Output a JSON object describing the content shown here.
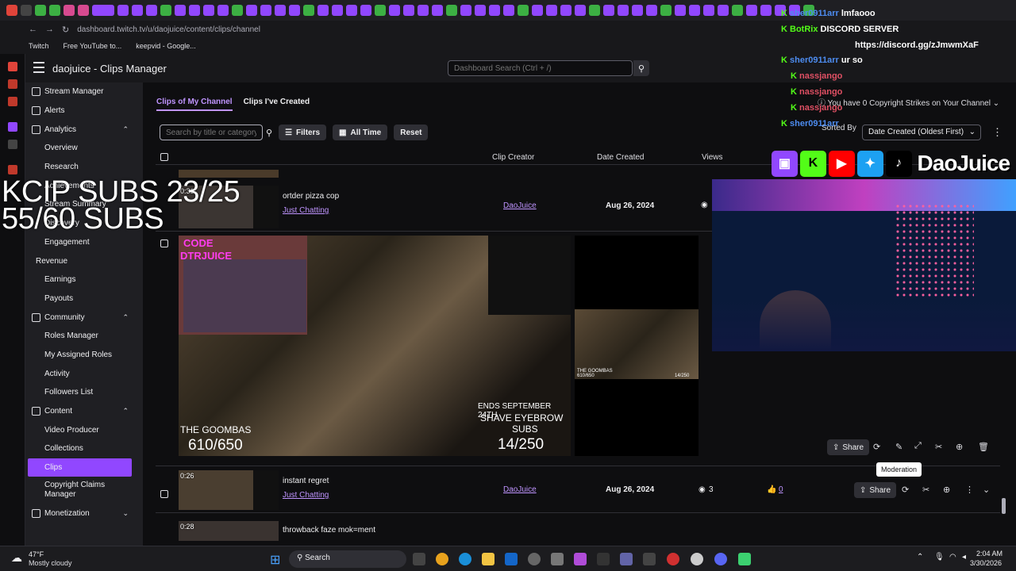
{
  "browser": {
    "url": "dashboard.twitch.tv/u/daojuice/content/clips/channel",
    "bookmarks": [
      "Twitch",
      "Free YouTube to...",
      "keepvid - Google..."
    ],
    "active_tab_label": "da"
  },
  "app": {
    "title": "daojuice - Clips Manager",
    "search_placeholder": "Dashboard Search (Ctrl + /)"
  },
  "nav": {
    "items": [
      {
        "label": "Stream Manager",
        "type": "top"
      },
      {
        "label": "Alerts",
        "type": "top"
      },
      {
        "label": "Analytics",
        "type": "top",
        "expanded": true
      },
      {
        "label": "Overview",
        "type": "sub"
      },
      {
        "label": "Research",
        "type": "sub"
      },
      {
        "label": "Achievements",
        "type": "sub"
      },
      {
        "label": "Stream Summary",
        "type": "sub"
      },
      {
        "label": "Discovery",
        "type": "sub"
      },
      {
        "label": "Engagement",
        "type": "sub"
      },
      {
        "label": "Revenue",
        "type": "sub-head"
      },
      {
        "label": "Earnings",
        "type": "sub"
      },
      {
        "label": "Payouts",
        "type": "sub"
      },
      {
        "label": "Community",
        "type": "top",
        "expanded": true
      },
      {
        "label": "Roles Manager",
        "type": "sub"
      },
      {
        "label": "My Assigned Roles",
        "type": "sub"
      },
      {
        "label": "Activity",
        "type": "sub"
      },
      {
        "label": "Followers List",
        "type": "sub"
      },
      {
        "label": "Content",
        "type": "top",
        "expanded": true
      },
      {
        "label": "Video Producer",
        "type": "sub"
      },
      {
        "label": "Collections",
        "type": "sub"
      },
      {
        "label": "Clips",
        "type": "sub",
        "active": true
      },
      {
        "label": "Copyright Claims Manager",
        "type": "sub"
      },
      {
        "label": "Monetization",
        "type": "top",
        "expanded": false
      }
    ]
  },
  "clips": {
    "tabs": [
      "Clips of My Channel",
      "Clips I've Created"
    ],
    "search_placeholder": "Search by title or category",
    "filters_label": "Filters",
    "time_label": "All Time",
    "reset_label": "Reset",
    "copyright_notice": "You have 0 Copyright Strikes on Your Channel",
    "sorted_by_label": "Sorted By",
    "sort_value": "Date Created (Oldest First)",
    "columns": [
      "Clip Creator",
      "Date Created",
      "Views"
    ],
    "rows": [
      {
        "duration": "0:31",
        "title": "ortder pizza cop",
        "category": "Just Chatting",
        "creator": "DaoJuice",
        "date": "Aug 26, 2024"
      },
      {
        "duration": "0:26",
        "title": "instant regret",
        "category": "Just Chatting",
        "creator": "DaoJuice",
        "date": "Aug 26, 2024",
        "views": "3",
        "likes": "0"
      },
      {
        "duration": "0:28",
        "title": "throwback faze mok=ment"
      }
    ],
    "share_label": "Share",
    "tooltip": "Moderation",
    "preview_texts": {
      "code": "CODE",
      "dtr": "DTRJUICE",
      "goombas": "THE GOOMBAS",
      "goombas_count": "610/650",
      "ends": "ENDS SEPTEMBER 24TH",
      "shave": "SHAVE EYEBROW",
      "subs": "SUBS",
      "shave_count": "14/250",
      "small_a": "THE GOOMBAS",
      "small_b": "610/650",
      "small_c": "14/250"
    }
  },
  "overlay": {
    "line1": "KCIP SUBS 23/25",
    "line2": "55/60 SUBS",
    "brand": "DaoJuice"
  },
  "chat": [
    {
      "user": "sher0911arr",
      "msg": "lmfaooo",
      "color": "blue"
    },
    {
      "user": "BotRix",
      "msg": "DISCORD SERVER",
      "color": "green"
    },
    {
      "user": "",
      "msg": "https://discord.gg/zJmwmXaF",
      "color": "white"
    },
    {
      "user": "sher0911arr",
      "msg": "ur so",
      "color": "blue"
    },
    {
      "user": "nassjango",
      "msg": "",
      "color": "red"
    },
    {
      "user": "nassjango",
      "msg": "",
      "color": "red"
    },
    {
      "user": "nassjango",
      "msg": "",
      "color": "red"
    },
    {
      "user": "sher0911arr",
      "msg": "",
      "color": "blue"
    }
  ],
  "taskbar": {
    "weather_temp": "47°F",
    "weather_desc": "Mostly cloudy",
    "search_label": "Search",
    "time": "2:04 AM",
    "date": "3/30/2026"
  }
}
